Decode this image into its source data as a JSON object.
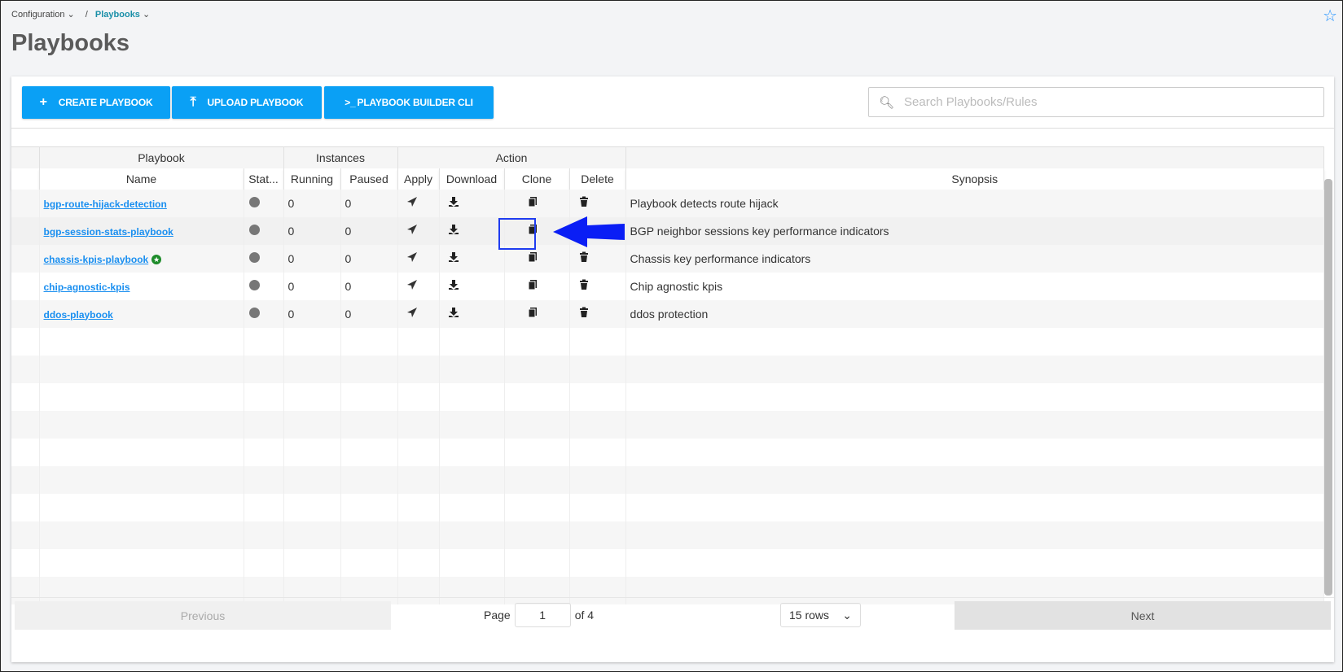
{
  "breadcrumb": {
    "parent": "Configuration",
    "current": "Playbooks"
  },
  "page_title": "Playbooks",
  "toolbar": {
    "create": "CREATE PLAYBOOK",
    "upload": "UPLOAD PLAYBOOK",
    "cli": "PLAYBOOK BUILDER CLI",
    "cli_icon": ">_"
  },
  "search": {
    "placeholder": "Search Playbooks/Rules"
  },
  "table": {
    "groups": {
      "playbook": "Playbook",
      "instances": "Instances",
      "action": "Action"
    },
    "columns": {
      "name": "Name",
      "status": "Stat...",
      "running": "Running",
      "paused": "Paused",
      "apply": "Apply",
      "download": "Download",
      "clone": "Clone",
      "delete": "Delete",
      "synopsis": "Synopsis"
    },
    "rows": [
      {
        "name": "bgp-route-hijack-detection",
        "running": "0",
        "paused": "0",
        "synopsis": "Playbook detects route hijack",
        "delete": true
      },
      {
        "name": "bgp-session-stats-playbook",
        "running": "0",
        "paused": "0",
        "synopsis": "BGP neighbor sessions key performance indicators",
        "delete": false
      },
      {
        "name": "chassis-kpis-playbook",
        "running": "0",
        "paused": "0",
        "synopsis": "Chassis key performance indicators",
        "delete": true,
        "badge": true
      },
      {
        "name": "chip-agnostic-kpis",
        "running": "0",
        "paused": "0",
        "synopsis": "Chip agnostic kpis",
        "delete": true
      },
      {
        "name": "ddos-playbook",
        "running": "0",
        "paused": "0",
        "synopsis": "ddos protection",
        "delete": true
      }
    ]
  },
  "pagination": {
    "previous": "Previous",
    "page_label": "Page",
    "page": "1",
    "of": "of 4",
    "rows": "15 rows",
    "next": "Next"
  },
  "colors": {
    "accent": "#0aa0f5",
    "link": "#1a8ff0",
    "highlight": "#1f3cf0",
    "arrow": "#0a1ef5"
  }
}
